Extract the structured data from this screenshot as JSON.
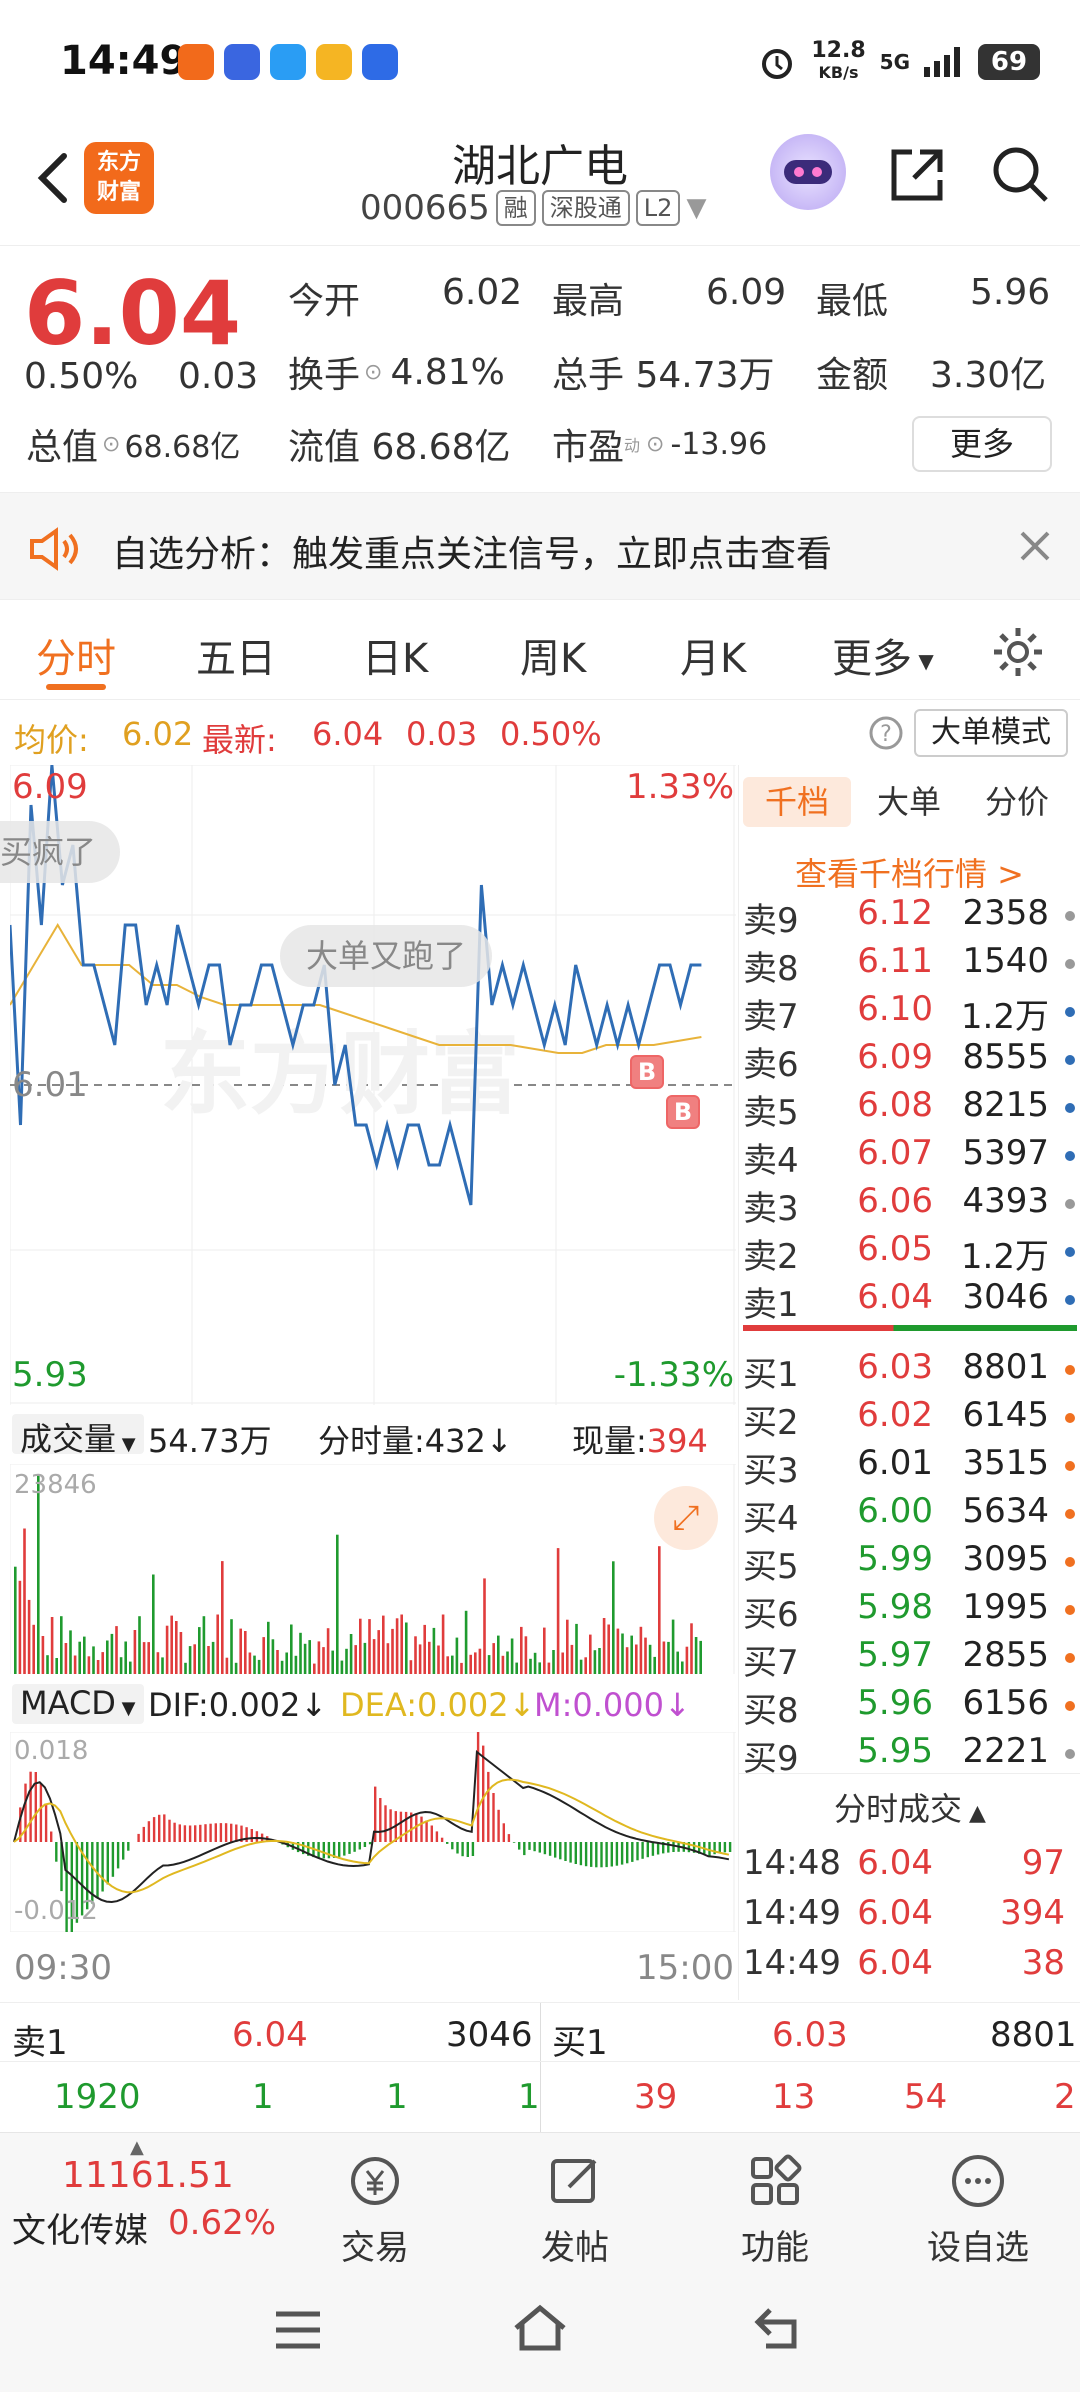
{
  "status": {
    "time": "14:49",
    "net_speed": "12.8",
    "net_unit": "KB/s",
    "signal": "5G",
    "battery": "69"
  },
  "header": {
    "title": "湖北广电",
    "code": "000665",
    "tags": [
      "融",
      "深股通",
      "L2"
    ],
    "logo_line1": "东方",
    "logo_line2": "财富"
  },
  "quote": {
    "price": "6.04",
    "change_pct": "0.50%",
    "change": "0.03",
    "open_label": "今开",
    "open": "6.02",
    "high_label": "最高",
    "high": "6.09",
    "low_label": "最低",
    "low": "5.96",
    "turnover_label": "换手",
    "turnover": "4.81%",
    "volume_label": "总手",
    "volume": "54.73万",
    "amount_label": "金额",
    "amount": "3.30亿",
    "mktcap_label": "总值",
    "mktcap": "68.68亿",
    "float_label": "流值",
    "float_cap": "68.68亿",
    "pe_label": "市盈",
    "pe_sup": "动",
    "pe": "-13.96",
    "more": "更多"
  },
  "banner": {
    "text": "自选分析：触发重点关注信号，立即点击查看"
  },
  "tabs": [
    "分时",
    "五日",
    "日K",
    "周K",
    "月K",
    "更多"
  ],
  "info": {
    "avg_label": "均价:",
    "avg": "6.02",
    "latest_label": "最新:",
    "latest": "6.04",
    "chg": "0.03",
    "chg_pct": "0.50%",
    "mode": "大单模式"
  },
  "chart": {
    "top_price": "6.09",
    "top_pct": "1.33%",
    "mid_price": "6.01",
    "bottom_price": "5.93",
    "bottom_pct": "-1.33%",
    "bubble1": "买疯了",
    "bubble2": "大单又跑了",
    "marker": "B",
    "watermark": "东方财富",
    "ylim": [
      5.93,
      6.09
    ]
  },
  "chart_data": {
    "type": "line",
    "series": [
      {
        "values": [
          6.05,
          6.0,
          6.08,
          6.05,
          6.09,
          6.06,
          6.07,
          6.04,
          6.04,
          6.03,
          6.02,
          6.05,
          6.05,
          6.03,
          6.04,
          6.03,
          6.05,
          6.04,
          6.03,
          6.04,
          6.04,
          6.02,
          6.03,
          6.03,
          6.04,
          6.04,
          6.03,
          6.02,
          6.03,
          6.03,
          6.04,
          6.01,
          6.02,
          6.0,
          6.0,
          5.99,
          6.0,
          5.99,
          6.0,
          6.0,
          5.99,
          5.99,
          6.0,
          5.99,
          5.98,
          6.06,
          6.03,
          6.04,
          6.03,
          6.04,
          6.03,
          6.02,
          6.03,
          6.02,
          6.04,
          6.03,
          6.02,
          6.03,
          6.02,
          6.03,
          6.02,
          6.03,
          6.04,
          6.04,
          6.03,
          6.04,
          6.04
        ]
      },
      {
        "values": [
          6.03,
          6.04,
          6.05,
          6.04,
          6.04,
          6.04,
          6.035,
          6.035,
          6.032,
          6.03,
          6.03,
          6.03,
          6.03,
          6.03,
          6.028,
          6.026,
          6.024,
          6.022,
          6.02,
          6.02,
          6.02,
          6.02,
          6.019,
          6.018,
          6.018,
          6.02,
          6.02,
          6.02,
          6.021,
          6.022
        ]
      }
    ],
    "ylim": [
      5.93,
      6.09
    ]
  },
  "book": {
    "tabs": [
      "千档",
      "大单",
      "分价"
    ],
    "link": "查看千档行情 >",
    "asks": [
      {
        "label": "卖9",
        "price": "6.12",
        "vol": "2358",
        "color": "gray"
      },
      {
        "label": "卖8",
        "price": "6.11",
        "vol": "1540",
        "color": "gray"
      },
      {
        "label": "卖7",
        "price": "6.10",
        "vol": "1.2万",
        "color": "blue"
      },
      {
        "label": "卖6",
        "price": "6.09",
        "vol": "8555",
        "color": "blue"
      },
      {
        "label": "卖5",
        "price": "6.08",
        "vol": "8215",
        "color": "blue"
      },
      {
        "label": "卖4",
        "price": "6.07",
        "vol": "5397",
        "color": "blue"
      },
      {
        "label": "卖3",
        "price": "6.06",
        "vol": "4393",
        "color": "gray"
      },
      {
        "label": "卖2",
        "price": "6.05",
        "vol": "1.2万",
        "color": "blue"
      },
      {
        "label": "卖1",
        "price": "6.04",
        "vol": "3046",
        "color": "blue"
      }
    ],
    "bids": [
      {
        "label": "买1",
        "price": "6.03",
        "vol": "8801",
        "color": "orange"
      },
      {
        "label": "买2",
        "price": "6.02",
        "vol": "6145",
        "color": "orange"
      },
      {
        "label": "买3",
        "price": "6.01",
        "vol": "3515",
        "color": "orange"
      },
      {
        "label": "买4",
        "price": "6.00",
        "vol": "5634",
        "color": "orange"
      },
      {
        "label": "买5",
        "price": "5.99",
        "vol": "3095",
        "color": "orange"
      },
      {
        "label": "买6",
        "price": "5.98",
        "vol": "1995",
        "color": "orange"
      },
      {
        "label": "买7",
        "price": "5.97",
        "vol": "2855",
        "color": "orange"
      },
      {
        "label": "买8",
        "price": "5.96",
        "vol": "6156",
        "color": "orange"
      },
      {
        "label": "买9",
        "price": "5.95",
        "vol": "2221",
        "color": "gray"
      }
    ],
    "ticks_title": "分时成交",
    "ticks": [
      {
        "time": "14:48",
        "price": "6.04",
        "vol": "97"
      },
      {
        "time": "14:49",
        "price": "6.04",
        "vol": "394"
      },
      {
        "time": "14:49",
        "price": "6.04",
        "vol": "38"
      }
    ]
  },
  "volume": {
    "label": "成交量",
    "total": "54.73万",
    "minute": "分时量:432",
    "current_label": "现量:",
    "current": "394",
    "max": "23846"
  },
  "macd": {
    "label": "MACD",
    "dif": "DIF:0.002",
    "dea": "DEA:0.002",
    "m": "M:0.000",
    "top": "0.018",
    "bottom": "-0.012",
    "start_time": "09:30",
    "end_time": "15:00"
  },
  "bottom_quotes": {
    "sell_label": "卖1",
    "sell_price": "6.04",
    "sell_vol": "3046",
    "buy_label": "买1",
    "buy_price": "6.03",
    "buy_vol": "8801",
    "row2": [
      "1920",
      "1",
      "1",
      "1",
      "39",
      "13",
      "54",
      "2"
    ]
  },
  "footer": {
    "index_value": "11161.51",
    "index_name": "文化传媒",
    "index_pct": "0.62%",
    "items": [
      "交易",
      "发帖",
      "功能",
      "设自选"
    ]
  }
}
